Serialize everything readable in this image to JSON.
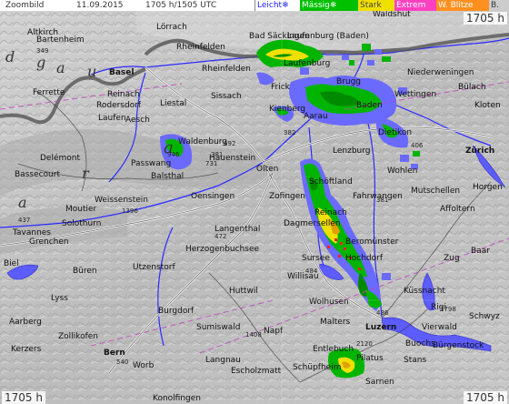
{
  "header": {
    "product": "Zoombild",
    "date": "11.09.2015",
    "time": "1705 h/1505 UTC"
  },
  "legend": {
    "items": [
      {
        "label": "Leicht",
        "symbol": "❄",
        "bg": "#ffffff",
        "fg": "#2020ff"
      },
      {
        "label": "Mässig",
        "symbol": "❄",
        "bg": "#00c000",
        "fg": "#ffffff"
      },
      {
        "label": "Stark",
        "symbol": "",
        "bg": "#f0e000",
        "fg": "#444444"
      },
      {
        "label": "Extrem",
        "symbol": "",
        "bg": "#ff40c0",
        "fg": "#ffffff"
      },
      {
        "label": "W. Blitze",
        "symbol": "",
        "bg": "#ff9020",
        "fg": "#ffffff"
      },
      {
        "label": "B.",
        "symbol": "",
        "bg": "#cccccc",
        "fg": "#333333"
      }
    ]
  },
  "corner_time": "1705 h",
  "colors": {
    "radar_light": "#6a6aff",
    "radar_moderate": "#00b400",
    "radar_moderate_dark": "#008a00",
    "radar_strong": "#f0e000",
    "radar_extreme": "#ff40c0",
    "lightning": "#ff2020",
    "river": "#2a2aff",
    "border": "#606060",
    "terrain": "#bdbdbd"
  },
  "places": [
    "Zoombild",
    "Altkirch",
    "Bartenheim",
    "Lörrach",
    "Rheinfelden",
    "Bad Säckingen",
    "Laufenburg",
    "Laufenburg (Baden)",
    "Waldshut",
    "Basel",
    "Rheinfelden",
    "Frick",
    "Brugg",
    "Baden",
    "Wettingen",
    "Niederweningen",
    "Bülach",
    "Kloten",
    "Ferrette",
    "Reinach",
    "Rodersdorf",
    "Liestal",
    "Sissach",
    "Kienberg",
    "Aarau",
    "Lenzburg",
    "Dietikon",
    "Zürich",
    "Laufen",
    "Delémont",
    "Passwang",
    "Waldenburg",
    "Hauenstein",
    "Olten",
    "Wohlen",
    "Balsthal",
    "Bassecourt",
    "Oensingen",
    "Zofingen",
    "Schöftland",
    "Fahrwangen",
    "Weissenstein",
    "Moutier",
    "Reinach",
    "Dagmersellen",
    "Beromünster",
    "Solothurn",
    "Langenthal",
    "Tavannes",
    "Grenchen",
    "Herzogenbuchsee",
    "Hochdorf",
    "Sursee",
    "Biel",
    "Büren",
    "Utzenstorf",
    "Willisau",
    "Küssnacht",
    "Huttwil",
    "Wolhusen",
    "Lyss",
    "Burgdorf",
    "Sumiswald",
    "Napf",
    "Malters",
    "Luzern",
    "Aarberg",
    "Zollikofen",
    "Entlebuch",
    "Schüpfheim",
    "Pilatus",
    "Sarnen",
    "Bern",
    "Worb",
    "Langnau",
    "Escholzmatt",
    "Konolfingen",
    "Kerzers",
    "Buochs",
    "Stans",
    "Schwyz",
    "Vierwald",
    "Bürgenstock",
    "Rigi",
    "Zug",
    "Baar",
    "Affoltern",
    "Horgen",
    "Mutschellen",
    "Aesch"
  ],
  "numbers": [
    "349",
    "437",
    "692",
    "382",
    "946",
    "731",
    "1396",
    "472",
    "381",
    "484",
    "1798",
    "2120",
    "1408",
    "540",
    "436",
    "406",
    "381"
  ],
  "regions": [
    "d",
    "g",
    "a",
    "u",
    "r",
    "a",
    "a"
  ]
}
